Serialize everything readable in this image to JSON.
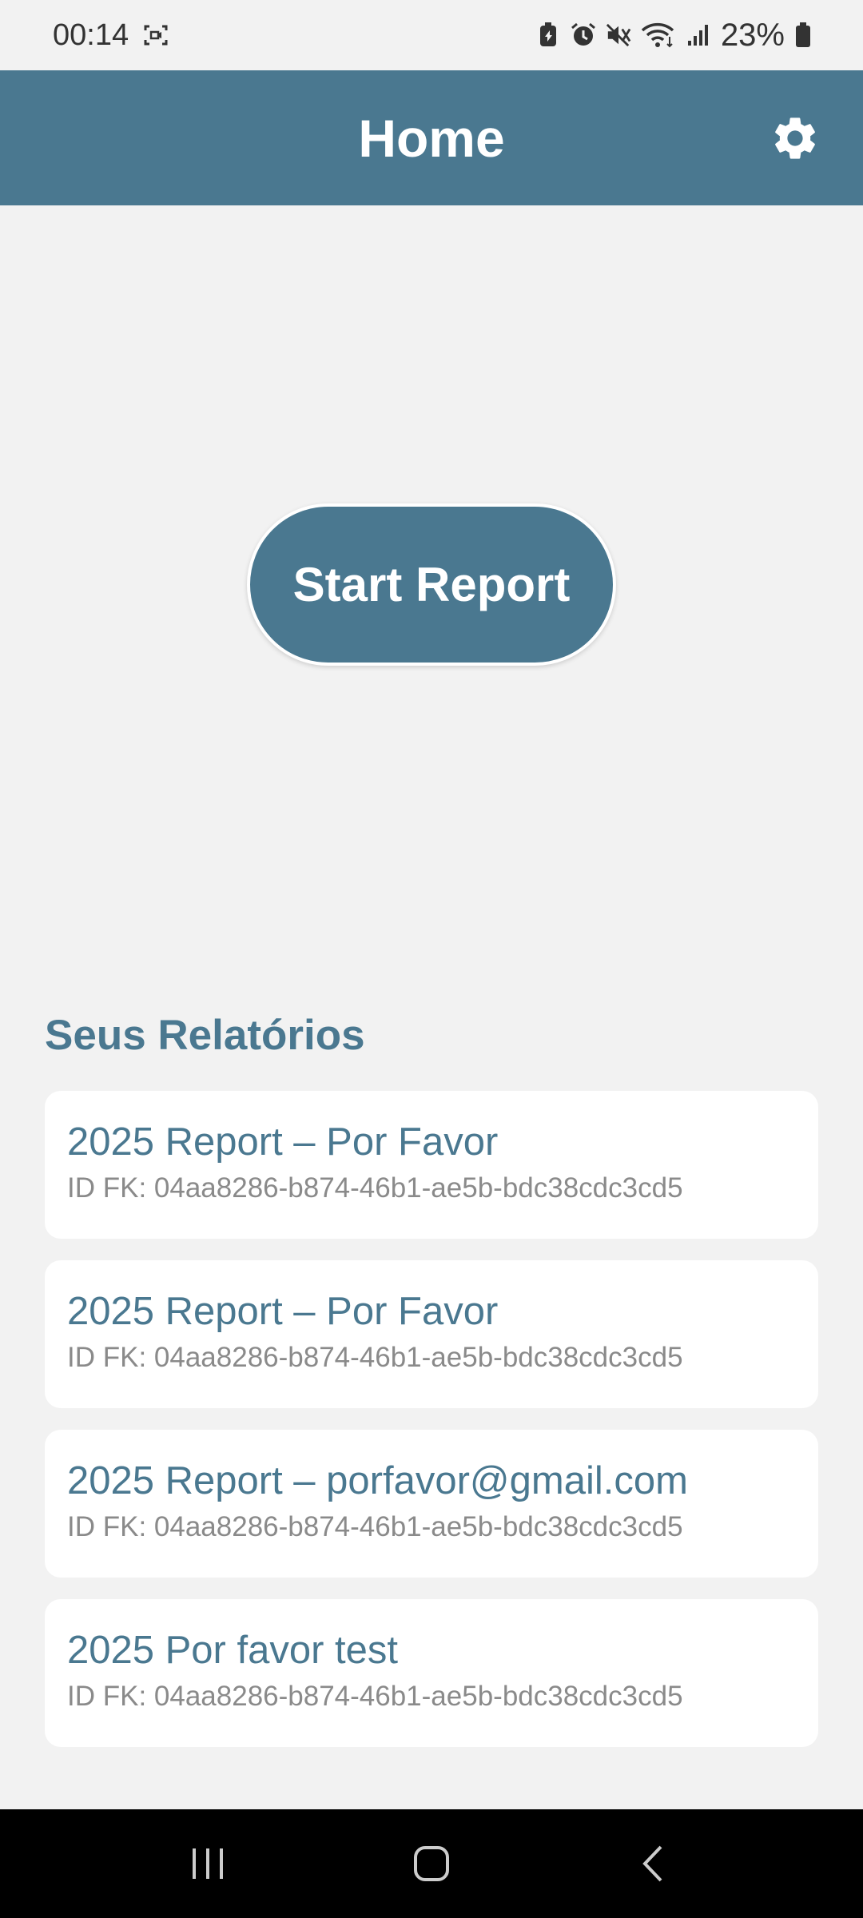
{
  "status_bar": {
    "time": "00:14",
    "battery_percent": "23%",
    "icons": [
      "screen-record-icon",
      "battery-saver-icon",
      "alarm-icon",
      "mute-icon",
      "wifi-icon",
      "signal-icon",
      "battery-icon"
    ]
  },
  "app_bar": {
    "title": "Home",
    "settings_icon": "gear-icon",
    "color": "#4a7890"
  },
  "main": {
    "start_button_label": "Start Report"
  },
  "reports": {
    "section_title": "Seus Relatórios",
    "items": [
      {
        "title": "2025 Report – Por Favor",
        "id": "ID FK: 04aa8286-b874-46b1-ae5b-bdc38cdc3cd5"
      },
      {
        "title": "2025 Report – Por Favor",
        "id": "ID FK: 04aa8286-b874-46b1-ae5b-bdc38cdc3cd5"
      },
      {
        "title": "2025 Report – porfavor@gmail.com",
        "id": "ID FK: 04aa8286-b874-46b1-ae5b-bdc38cdc3cd5"
      },
      {
        "title": "2025 Por favor test",
        "id": "ID FK: 04aa8286-b874-46b1-ae5b-bdc38cdc3cd5"
      }
    ]
  },
  "nav_bar": {
    "buttons": [
      "recents-icon",
      "home-icon",
      "back-icon"
    ]
  }
}
